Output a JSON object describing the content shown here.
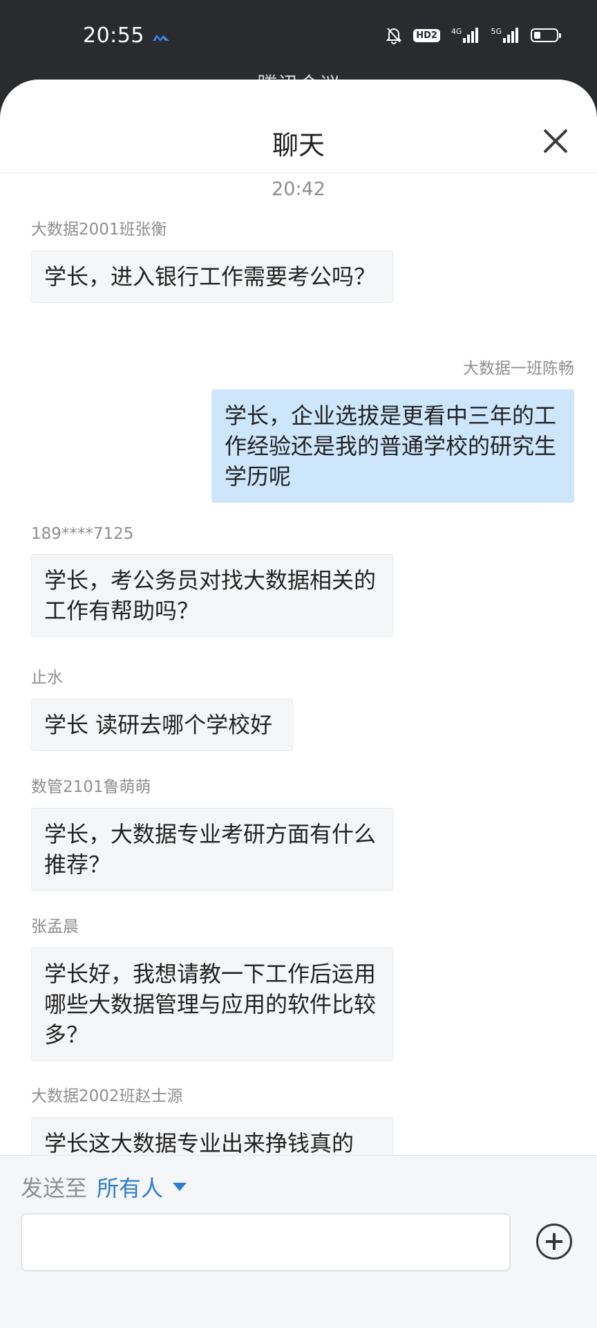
{
  "status_bar": {
    "time": "20:55",
    "hd_label": "HD2",
    "net1": "4G",
    "net2": "5G",
    "battery_level": 0.3
  },
  "background_title": "腾讯会议",
  "panel": {
    "title": "聊天"
  },
  "chat": {
    "timestamp": "20:42",
    "messages": [
      {
        "sender": "大数据2001班张衡",
        "text": "学长，进入银行工作需要考公吗？",
        "side": "left"
      },
      {
        "sender": "大数据一班陈畅",
        "text": "学长，企业选拔是更看中三年的工作经验还是我的普通学校的研究生学历呢",
        "side": "right"
      },
      {
        "sender": "189****7125",
        "text": "学长，考公务员对找大数据相关的工作有帮助吗？",
        "side": "left"
      },
      {
        "sender": "止水",
        "text": "学长 读研去哪个学校好",
        "side": "left"
      },
      {
        "sender": "数管2101鲁萌萌",
        "text": "学长，大数据专业考研方面有什么推荐？",
        "side": "left"
      },
      {
        "sender": "张孟晨",
        "text": "学长好，我想请教一下工作后运用哪些大数据管理与应用的软件比较多？",
        "side": "left"
      },
      {
        "sender": "大数据2002班赵士源",
        "text": "学长这大数据专业出来挣钱真的",
        "side": "left"
      }
    ]
  },
  "footer": {
    "send_to_label": "发送至",
    "send_to_target": "所有人",
    "input_value": "",
    "input_placeholder": ""
  }
}
